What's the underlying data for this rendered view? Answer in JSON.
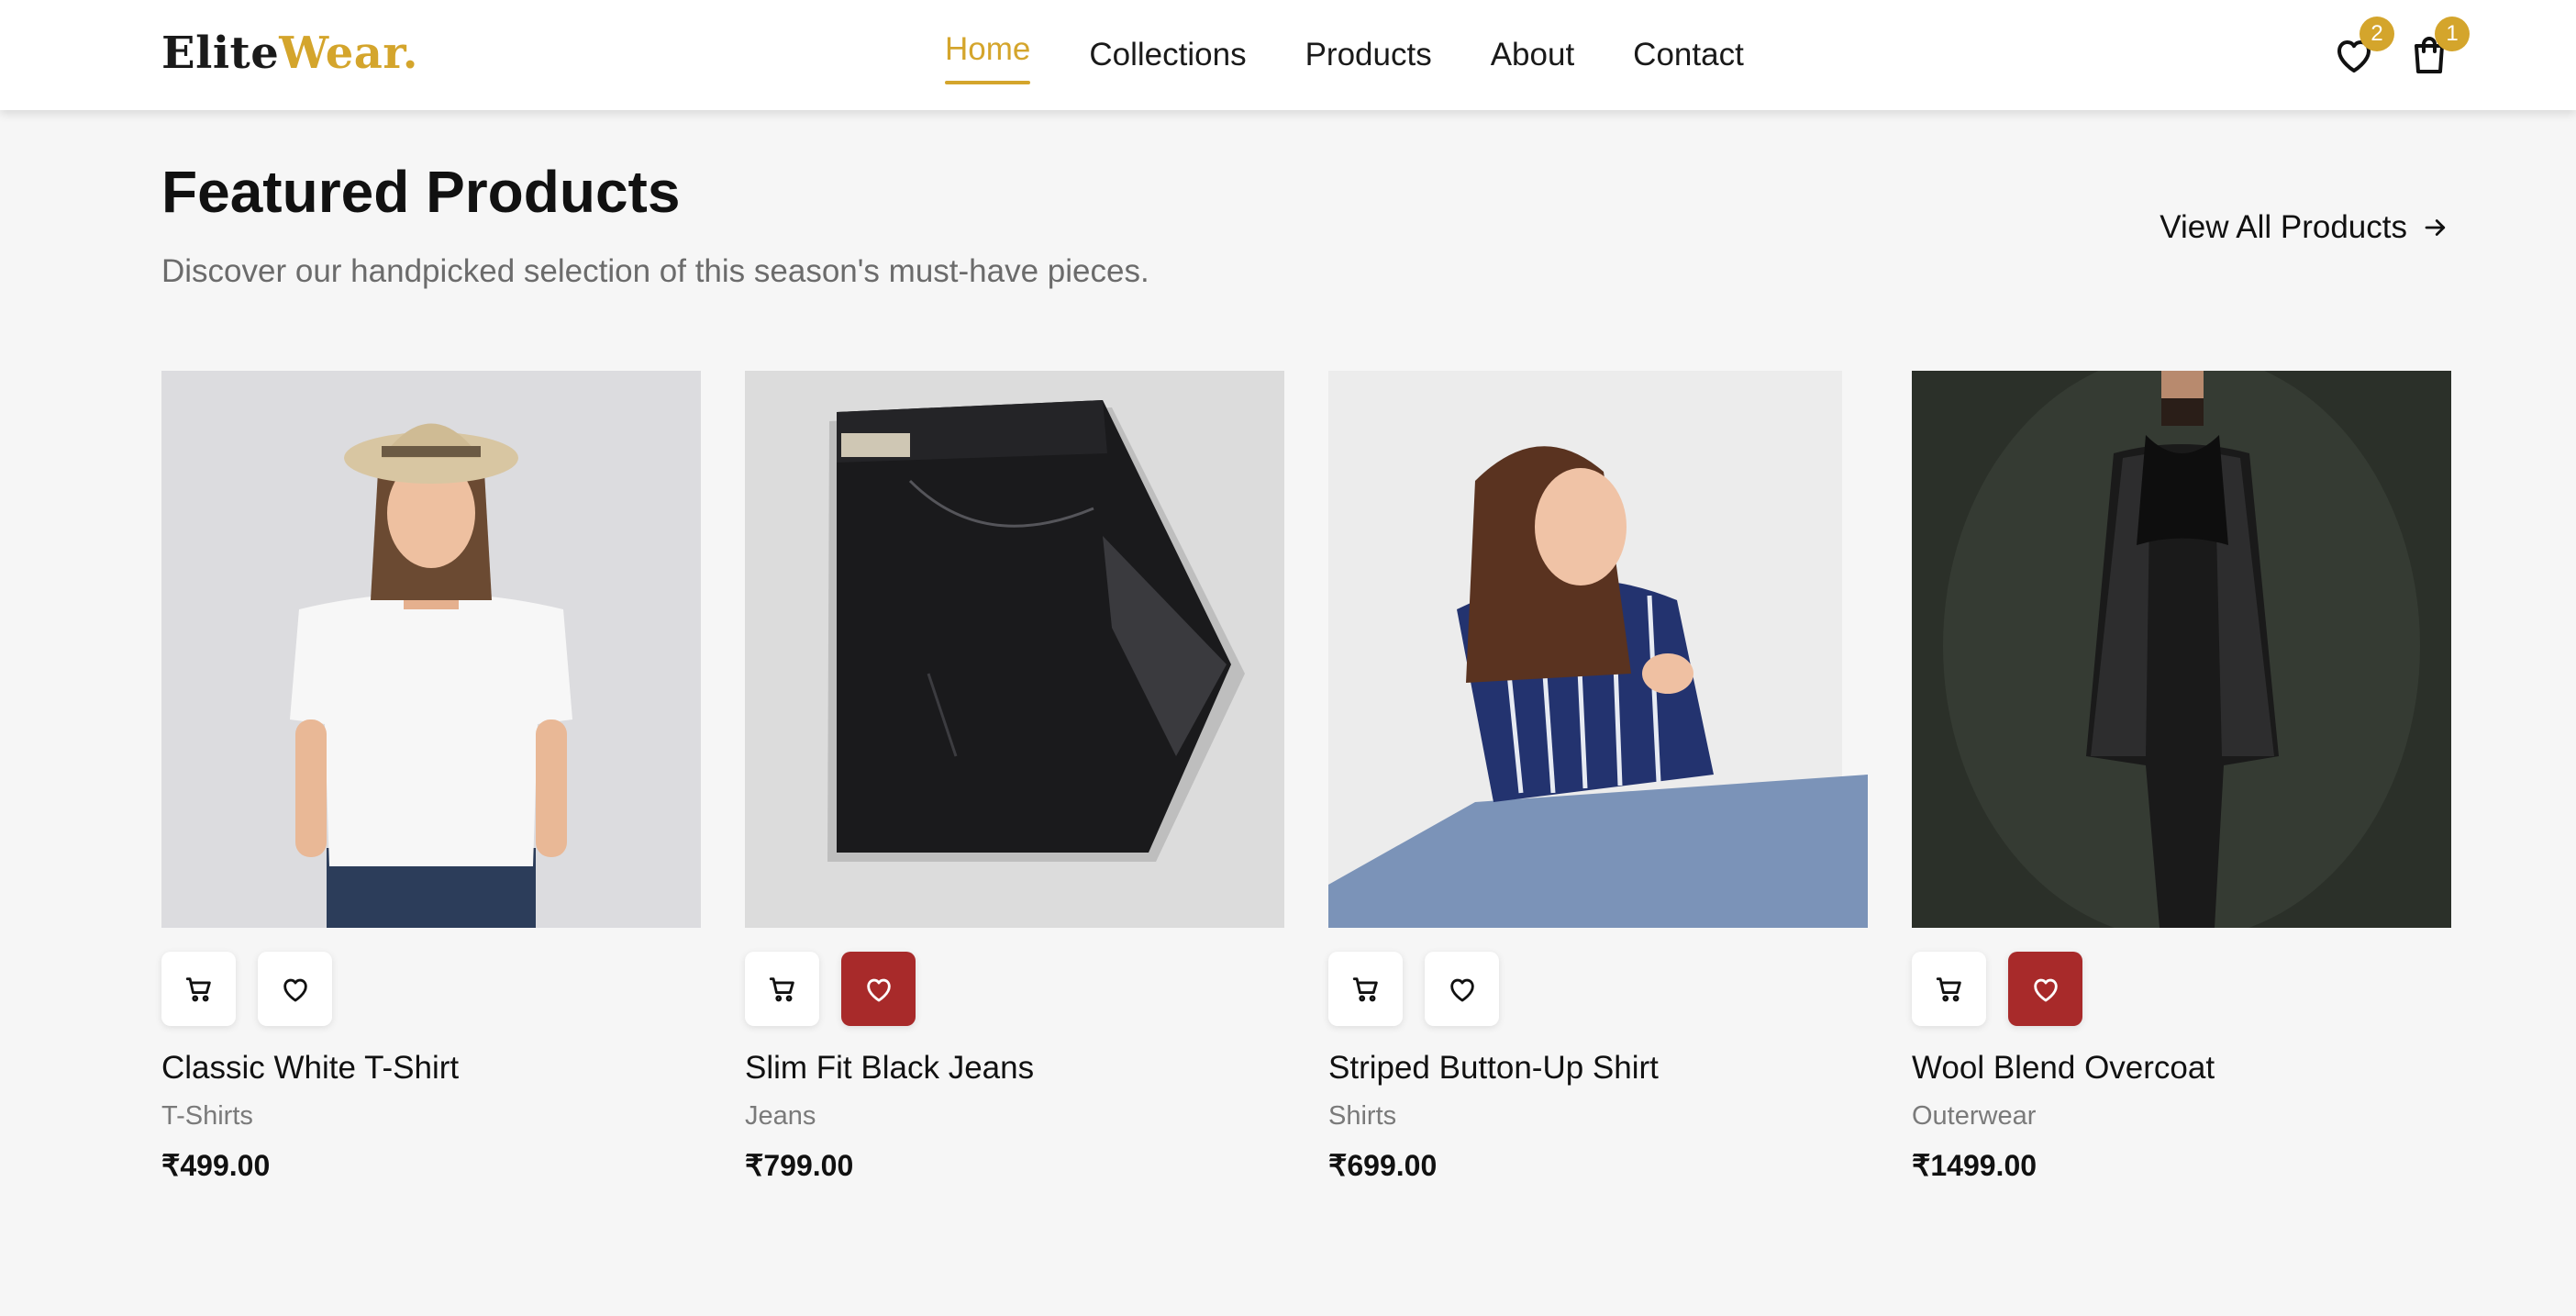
{
  "header": {
    "logo_part1": "Elite",
    "logo_part2": "Wear.",
    "nav": [
      {
        "label": "Home",
        "active": true
      },
      {
        "label": "Collections"
      },
      {
        "label": "Products"
      },
      {
        "label": "About"
      },
      {
        "label": "Contact"
      }
    ],
    "wishlist_icon": "heart-icon",
    "wishlist_count": "2",
    "cart_icon": "shopping-bag-icon",
    "cart_count": "1"
  },
  "section": {
    "title": "Featured Products",
    "subtitle": "Discover our handpicked selection of this season's must-have pieces.",
    "view_all": "View All Products",
    "view_all_icon": "arrow-right-icon"
  },
  "products": [
    {
      "name": "Classic White T-Shirt",
      "category": "T-Shirts",
      "price": "₹499.00",
      "wishlisted": false,
      "image_icon": "woman-white-tshirt-photo"
    },
    {
      "name": "Slim Fit Black Jeans",
      "category": "Jeans",
      "price": "₹799.00",
      "wishlisted": true,
      "image_icon": "folded-black-jeans-photo"
    },
    {
      "name": "Striped Button-Up Shirt",
      "category": "Shirts",
      "price": "₹699.00",
      "wishlisted": false,
      "image_icon": "woman-striped-shirt-photo"
    },
    {
      "name": "Wool Blend Overcoat",
      "category": "Outerwear",
      "price": "₹1499.00",
      "wishlisted": true,
      "image_icon": "man-overcoat-photo"
    }
  ],
  "colors": {
    "accent": "#d4a52c",
    "wishlist_active": "#a82a2a",
    "background": "#f6f6f6"
  }
}
